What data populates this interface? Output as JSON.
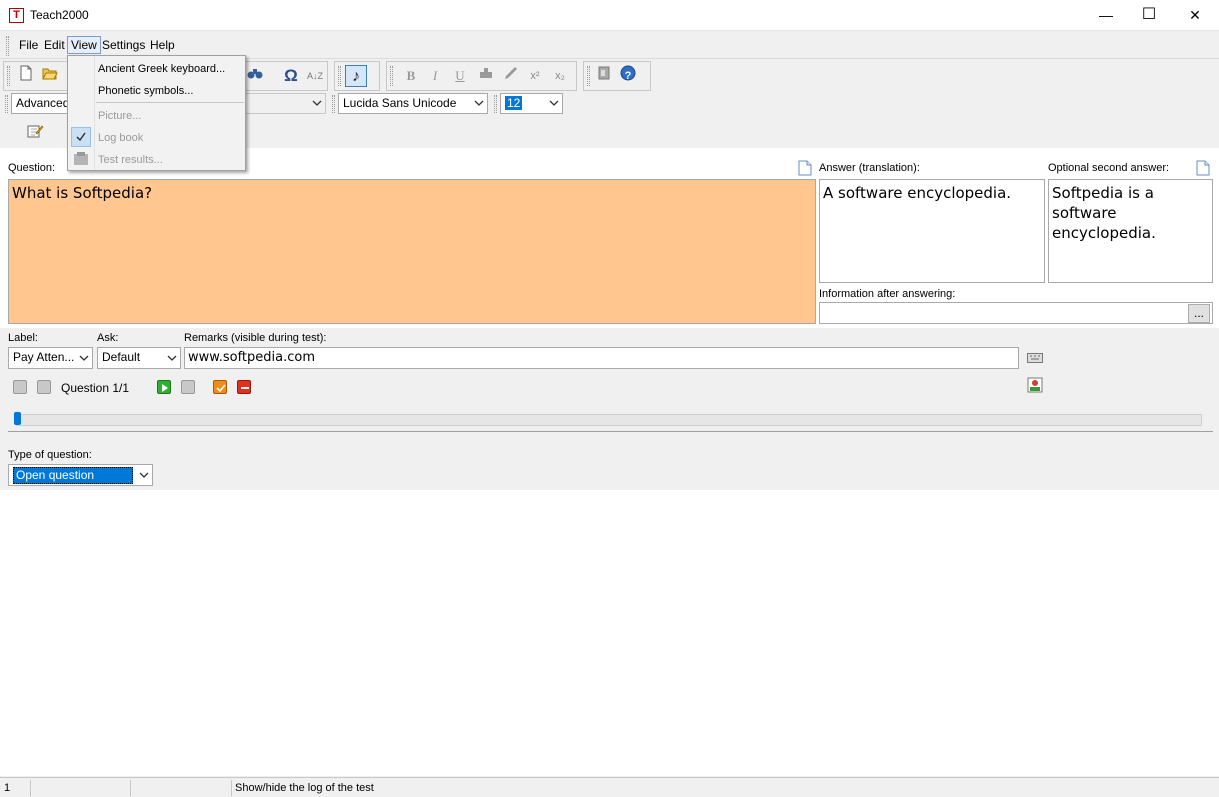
{
  "window": {
    "title": "Teach2000",
    "app_icon_letter": "T",
    "minimize_glyph": "—",
    "maximize_glyph": "☐",
    "close_glyph": "✕"
  },
  "menubar": {
    "items": [
      "File",
      "Edit",
      "View",
      "Settings",
      "Help"
    ],
    "open_menu": "View"
  },
  "view_menu": {
    "items": [
      {
        "label": "Ancient Greek keyboard...",
        "enabled": true
      },
      {
        "label": "Phonetic symbols...",
        "enabled": true
      },
      {
        "label": "Picture...",
        "enabled": false
      },
      {
        "label": "Log book",
        "enabled": false,
        "checked": true
      },
      {
        "label": "Test results...",
        "enabled": false
      }
    ]
  },
  "toolbar": {
    "mode_combo": "Advanced",
    "font_combo": "Lucida Sans Unicode",
    "size_combo": "12",
    "omega_glyph": "Ω",
    "sort_glyph": "A↓Z",
    "note_glyph": "♪",
    "bold_glyph": "B",
    "italic_glyph": "I",
    "underline_glyph": "U",
    "superscript_glyph": "x²",
    "subscript_glyph": "x₂",
    "help_glyph": "?"
  },
  "editor": {
    "question_label": "Question:",
    "question_text": "What is Softpedia?",
    "answer_label": "Answer (translation):",
    "answer_text": "A software encyclopedia.",
    "second_answer_label": "Optional second answer:",
    "second_answer_text": "Softpedia is a software encyclopedia.",
    "info_label": "Information after answering:",
    "info_button": "..."
  },
  "details": {
    "label_label": "Label:",
    "label_value": "Pay Atten...",
    "ask_label": "Ask:",
    "ask_value": "Default",
    "remarks_label": "Remarks (visible during test):",
    "remarks_value": "www.softpedia.com",
    "question_counter": "Question 1/1",
    "type_label": "Type of question:",
    "type_value": "Open question"
  },
  "statusbar": {
    "cell1": "1",
    "message": "Show/hide the log of the test"
  },
  "colors": {
    "question_bg": "#ffc690",
    "accent": "#0078d7"
  }
}
